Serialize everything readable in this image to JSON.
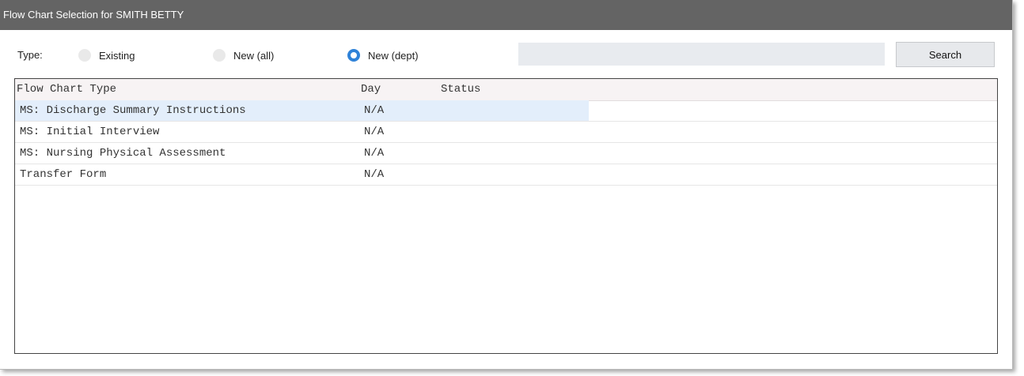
{
  "window": {
    "title": "Flow Chart Selection for SMITH BETTY"
  },
  "type_filter": {
    "label": "Type:",
    "options": [
      {
        "label": "Existing",
        "checked": false
      },
      {
        "label": "New (all)",
        "checked": false
      },
      {
        "label": "New (dept)",
        "checked": true
      }
    ]
  },
  "search": {
    "value": "",
    "placeholder": "",
    "button_label": "Search"
  },
  "grid": {
    "columns": [
      "Flow Chart Type",
      "Day",
      "Status"
    ],
    "rows": [
      {
        "type": "MS: Discharge Summary Instructions",
        "day": "N/A",
        "status": "",
        "selected": true
      },
      {
        "type": "MS: Initial Interview",
        "day": "N/A",
        "status": "",
        "selected": false
      },
      {
        "type": "MS: Nursing Physical Assessment",
        "day": "N/A",
        "status": "",
        "selected": false
      },
      {
        "type": "Transfer Form",
        "day": "N/A",
        "status": "",
        "selected": false
      }
    ]
  },
  "colors": {
    "accent": "#2f82d8",
    "titlebar": "#646464",
    "selection": "#e3eefb"
  }
}
